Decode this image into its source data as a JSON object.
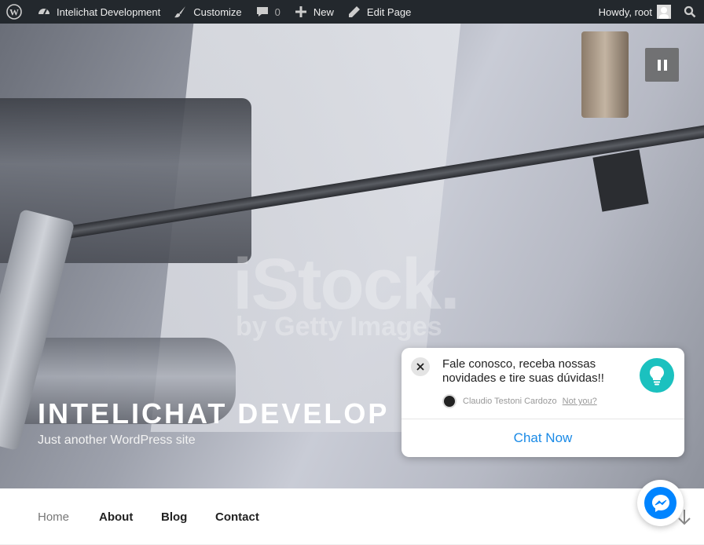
{
  "adminbar": {
    "site_name": "Intelichat Development",
    "customize": "Customize",
    "comments_count": "0",
    "new": "New",
    "edit_page": "Edit Page",
    "greeting": "Howdy, root"
  },
  "hero": {
    "title": "INTELICHAT DEVELOP",
    "tagline": "Just another WordPress site",
    "watermark_main": "iStock.",
    "watermark_sub": "by Getty Images"
  },
  "nav": {
    "items": [
      "Home",
      "About",
      "Blog",
      "Contact"
    ]
  },
  "chat": {
    "message": "Fale conosco, receba nossas novidades e tire suas dúvidas!!",
    "author": "Claudio Testoni Cardozo",
    "not_you": "Not you?",
    "cta": "Chat Now"
  },
  "colors": {
    "adminbar_bg": "#23282d",
    "chat_accent": "#1a8ae6",
    "bulb": "#1bc1bf",
    "messenger": "#0084ff"
  }
}
